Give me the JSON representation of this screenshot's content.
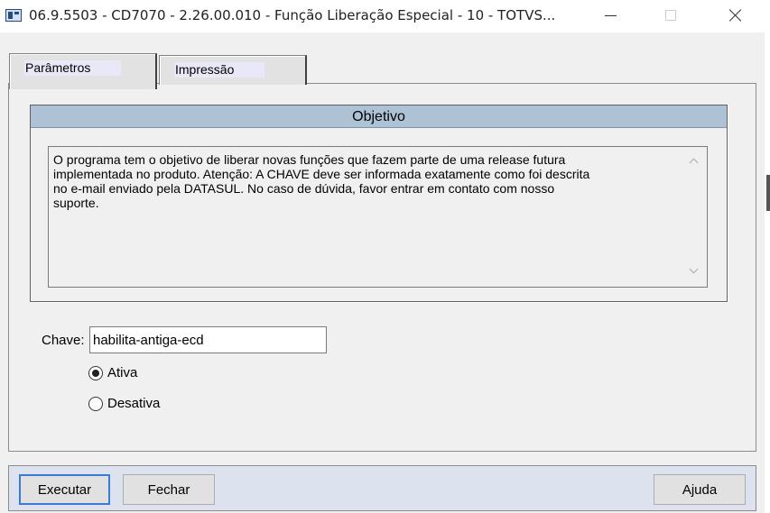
{
  "window": {
    "title": "06.9.5503 - CD7070 - 2.26.00.010 - Função Liberação Especial - 10 - TOTVS..."
  },
  "tabs": [
    {
      "label": "Parâmetros",
      "selected": true
    },
    {
      "label": "Impressão",
      "selected": false
    }
  ],
  "objetivo": {
    "heading": "Objetivo",
    "text": "O programa tem o objetivo de liberar novas funções que fazem parte de uma release futura\nimplementada no produto. Atenção: A CHAVE deve ser informada exatamente como foi descrita\nno e-mail enviado pela DATASUL. No caso de dúvida, favor entrar em contato com nosso\nsuporte."
  },
  "chave": {
    "label": "Chave:",
    "value": "habilita-antiga-ecd"
  },
  "options": {
    "ativa": {
      "label": "Ativa",
      "checked": true
    },
    "desativa": {
      "label": "Desativa",
      "checked": false
    }
  },
  "buttons": {
    "executar": "Executar",
    "fechar": "Fechar",
    "ajuda": "Ajuda"
  }
}
